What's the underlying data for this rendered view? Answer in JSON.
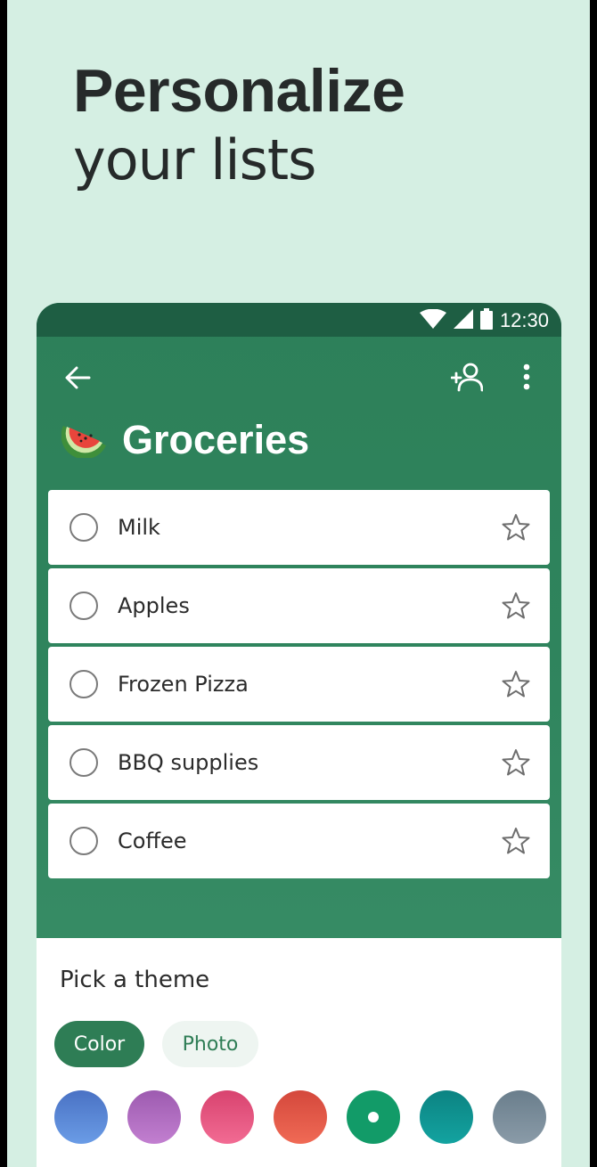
{
  "headline": {
    "line1": "Personalize",
    "line2": "your lists"
  },
  "status_bar": {
    "time": "12:30",
    "icons": [
      "wifi-icon",
      "signal-icon",
      "battery-icon"
    ]
  },
  "app_bar": {
    "icons": [
      "back-arrow-icon",
      "add-person-icon",
      "more-vertical-icon"
    ]
  },
  "list": {
    "emoji_icon": "watermelon-icon",
    "title": "Groceries",
    "tasks": [
      {
        "label": "Milk"
      },
      {
        "label": "Apples"
      },
      {
        "label": "Frozen Pizza"
      },
      {
        "label": "BBQ supplies"
      },
      {
        "label": "Coffee"
      }
    ]
  },
  "theme_sheet": {
    "title": "Pick a theme",
    "tabs": [
      {
        "label": "Color",
        "selected": true
      },
      {
        "label": "Photo",
        "selected": false
      }
    ],
    "swatches": [
      {
        "name": "blue",
        "from": "#4a72c4",
        "to": "#6a9ce6",
        "selected": false
      },
      {
        "name": "purple",
        "from": "#9d5bb0",
        "to": "#c27fd0",
        "selected": false
      },
      {
        "name": "pink",
        "from": "#d8436f",
        "to": "#f26b93",
        "selected": false
      },
      {
        "name": "red",
        "from": "#d4483c",
        "to": "#f06a55",
        "selected": false
      },
      {
        "name": "green",
        "from": "#129b68",
        "to": "#129b68",
        "selected": true
      },
      {
        "name": "teal",
        "from": "#0c8382",
        "to": "#13a3a0",
        "selected": false
      },
      {
        "name": "gray",
        "from": "#6a7e8c",
        "to": "#8a9ba8",
        "selected": false
      }
    ]
  },
  "colors": {
    "accent": "#2e7d55",
    "background": "#d5efe3",
    "header": "#2d8059",
    "status_bar": "#1e5e43"
  }
}
